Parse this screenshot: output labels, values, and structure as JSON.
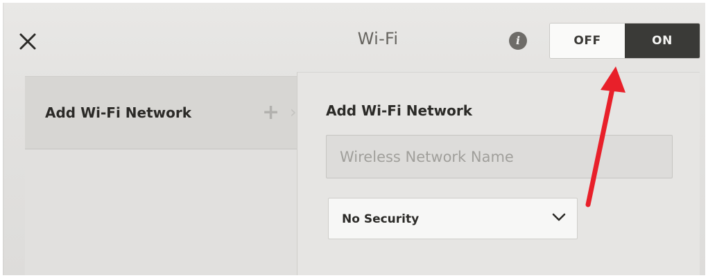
{
  "header": {
    "title": "Wi-Fi",
    "info_icon": "info-icon",
    "close_icon": "close-icon",
    "toggle": {
      "off_label": "OFF",
      "on_label": "ON",
      "selected": "ON"
    }
  },
  "sidebar": {
    "items": [
      {
        "label": "Add Wi-Fi Network",
        "plus_glyph": "+",
        "chevron_glyph": "›",
        "selected": true
      }
    ]
  },
  "form": {
    "title": "Add Wi-Fi Network",
    "network_name": {
      "value": "",
      "placeholder": "Wireless Network Name"
    },
    "security": {
      "selected": "No Security"
    }
  },
  "annotation": {
    "arrow_color": "#e8202a"
  }
}
